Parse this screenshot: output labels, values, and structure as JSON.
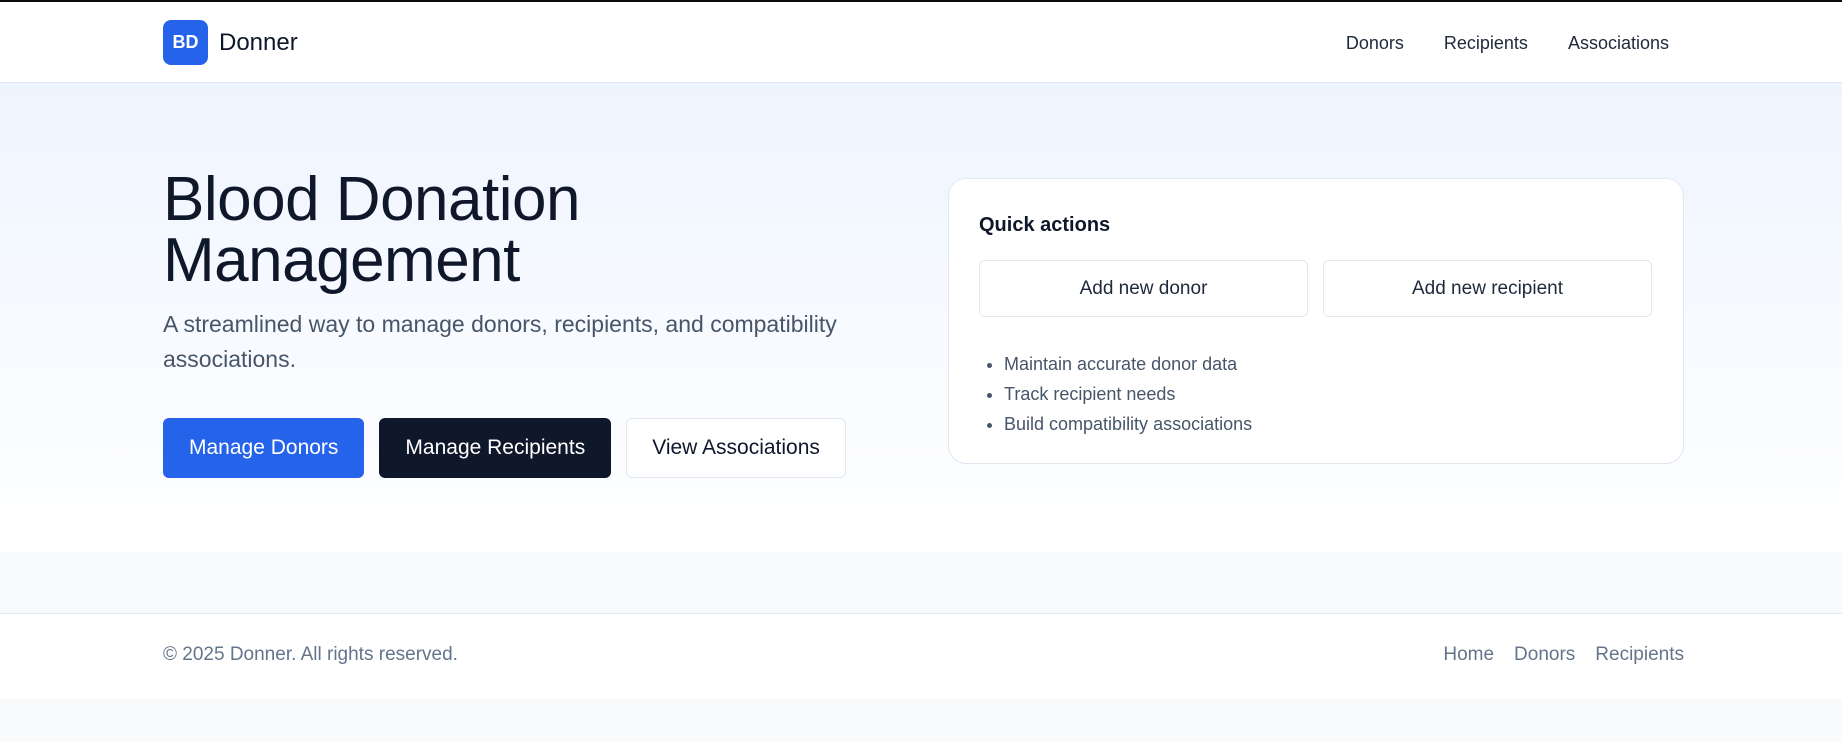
{
  "header": {
    "brand_badge": "BD",
    "brand_name": "Donner",
    "nav": [
      "Donors",
      "Recipients",
      "Associations"
    ]
  },
  "hero": {
    "title_line1": "Blood Donation",
    "title_line2": "Management",
    "subtitle": "A streamlined way to manage donors, recipients, and compatibility associations.",
    "buttons": {
      "manage_donors": "Manage Donors",
      "manage_recipients": "Manage Recipients",
      "view_associations": "View Associations"
    }
  },
  "quick_actions": {
    "title": "Quick actions",
    "add_donor": "Add new donor",
    "add_recipient": "Add new recipient",
    "items": [
      "Maintain accurate donor data",
      "Track recipient needs",
      "Build compatibility associations"
    ]
  },
  "footer": {
    "copyright": "© 2025 Donner. All rights reserved.",
    "links": [
      "Home",
      "Donors",
      "Recipients"
    ]
  },
  "colors": {
    "primary": "#2563eb",
    "dark": "#0f172a",
    "muted": "#64748b",
    "border": "#e2e8f0"
  }
}
